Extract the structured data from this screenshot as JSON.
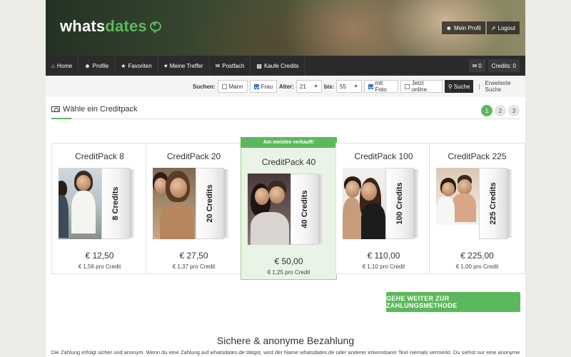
{
  "header": {
    "logo_part1": "whats",
    "logo_part2": "dates",
    "links": [
      {
        "icon": "user-icon",
        "label": "Mein Profil"
      },
      {
        "icon": "logout-icon",
        "label": "Logout"
      }
    ]
  },
  "nav": {
    "items": [
      {
        "icon": "home-icon",
        "label": "Home"
      },
      {
        "icon": "users-icon",
        "label": "Profile"
      },
      {
        "icon": "star-icon",
        "label": "Favoriten"
      },
      {
        "icon": "heart-icon",
        "label": "Meine Treffer"
      },
      {
        "icon": "envelope-icon",
        "label": "Postfach"
      },
      {
        "icon": "money-icon",
        "label": "Kaufe Credits"
      }
    ],
    "messages_count": "0",
    "credits_label": "Credits: 0"
  },
  "search": {
    "label": "Suchen:",
    "mann": "Mann",
    "frau": "Frau",
    "alter_label": "Alter:",
    "age_from": "21",
    "bis_label": "bis:",
    "age_to": "55",
    "mit_foto": "mit Foto",
    "jetzt_online": "Jetzt online",
    "search_button": "Suche",
    "advanced": "Erweiterte Suche"
  },
  "section": {
    "title": "Wähle ein Creditpack",
    "steps": [
      "1",
      "2",
      "3"
    ]
  },
  "packs": [
    {
      "name": "CreditPack 8",
      "box_label": "8 Credits",
      "price": "€ 12,50",
      "per": "€ 1,56 pro Credit"
    },
    {
      "name": "CreditPack 20",
      "box_label": "20 Credits",
      "price": "€ 27,50",
      "per": "€ 1,37 pro Credit"
    },
    {
      "name": "CreditPack 40",
      "box_label": "40 Credits",
      "price": "€ 50,00",
      "per": "€ 1,25 pro Credit",
      "ribbon": "Am meisten verkauft!"
    },
    {
      "name": "CreditPack 100",
      "box_label": "100 Credits",
      "price": "€ 110,00",
      "per": "€ 1,10 pro Credit"
    },
    {
      "name": "CreditPack 225",
      "box_label": "225 Credits",
      "price": "€ 225,00",
      "per": "€ 1,00 pro Credit"
    }
  ],
  "cta": "GEHE WEITER ZUR ZAHLUNGSMETHODE",
  "secure": {
    "title": "Sichere & anonyme Bezahlung",
    "text": "Die Zahlung erfolgt sicher und anonym. Wenn du eine Zahlung auf whatsdates.de tätigst, wird der Name whatsdates.de oder anderer erkennbarer Text niemals vermerkt. Du siehst nur eine anonyme"
  },
  "colors": {
    "accent": "#5cb85c",
    "navbar": "#2b2b2b"
  }
}
